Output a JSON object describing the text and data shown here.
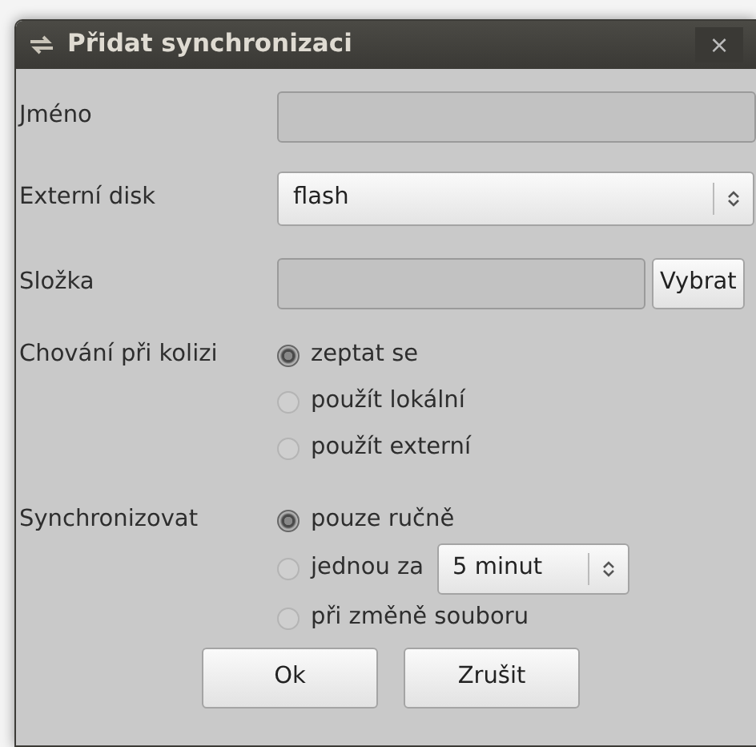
{
  "window": {
    "title": "Přidat synchronizaci",
    "close": "×"
  },
  "fields": [
    {
      "kind": "text",
      "label": "Jméno"
    },
    {
      "kind": "select",
      "label": "Externí disk",
      "value": "flash"
    },
    {
      "kind": "folder",
      "label": "Složka",
      "button": "Vybrat"
    }
  ],
  "groups": [
    {
      "label": "Chování při kolizi",
      "options": [
        {
          "label": "zeptat se",
          "selected": true
        },
        {
          "label": "použít lokální",
          "selected": false
        },
        {
          "label": "použít externí",
          "selected": false
        }
      ]
    },
    {
      "label": "Synchronizovat",
      "options": [
        {
          "label": "pouze ručně",
          "selected": true
        },
        {
          "label": "jednou za",
          "selected": false,
          "interval": "5 minut"
        },
        {
          "label": "při změně souboru",
          "selected": false
        }
      ]
    }
  ],
  "buttons": [
    "Ok",
    "Zrušit"
  ]
}
